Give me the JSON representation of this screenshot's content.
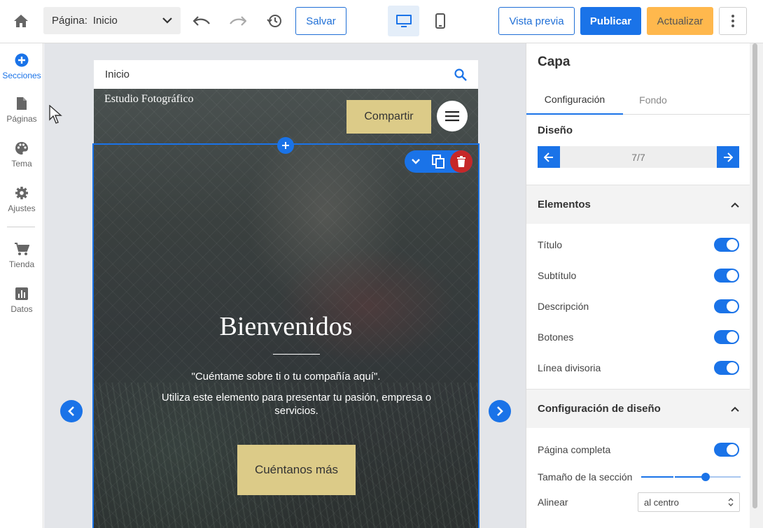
{
  "topbar": {
    "page_label": "Página:",
    "page_value": "Inicio",
    "save_label": "Salvar",
    "preview_label": "Vista previa",
    "publish_label": "Publicar",
    "update_label": "Actualizar"
  },
  "leftnav": {
    "items": [
      {
        "label": "Secciones",
        "icon": "add-circle-icon",
        "active": true
      },
      {
        "label": "Páginas",
        "icon": "page-icon"
      },
      {
        "label": "Tema",
        "icon": "palette-icon"
      },
      {
        "label": "Ajustes",
        "icon": "gear-icon"
      },
      {
        "label": "Tienda",
        "icon": "cart-icon"
      },
      {
        "label": "Datos",
        "icon": "chart-icon"
      }
    ]
  },
  "canvas": {
    "site_header_title": "Inicio",
    "brand": "Estudio Fotográfico",
    "share_label": "Compartir",
    "hero_title": "Bienvenidos",
    "hero_subtitle": "\"Cuéntame sobre ti o tu compañía aquí\".",
    "hero_description": "Utiliza este elemento para presentar tu pasión, empresa o servicios.",
    "cta_label": "Cuéntanos más"
  },
  "panel": {
    "title": "Capa",
    "tabs": [
      {
        "label": "Configuración",
        "active": true
      },
      {
        "label": "Fondo",
        "active": false
      }
    ],
    "design_label": "Diseño",
    "layout_counter": "7/7",
    "elements_header": "Elementos",
    "elements": [
      {
        "label": "Título",
        "on": true
      },
      {
        "label": "Subtítulo",
        "on": true
      },
      {
        "label": "Descripción",
        "on": true
      },
      {
        "label": "Botones",
        "on": true
      },
      {
        "label": "Línea divisoria",
        "on": true
      }
    ],
    "design_settings_header": "Configuración de diseño",
    "full_page_label": "Página completa",
    "full_page_on": true,
    "section_size_label": "Tamaño de la sección",
    "section_size_value": 0.65,
    "align_label": "Alinear",
    "align_value": "al centro"
  },
  "colors": {
    "accent": "#1a73e8",
    "update_button": "#ffb84d",
    "hero_button": "#dccb88",
    "delete": "#c62828"
  }
}
